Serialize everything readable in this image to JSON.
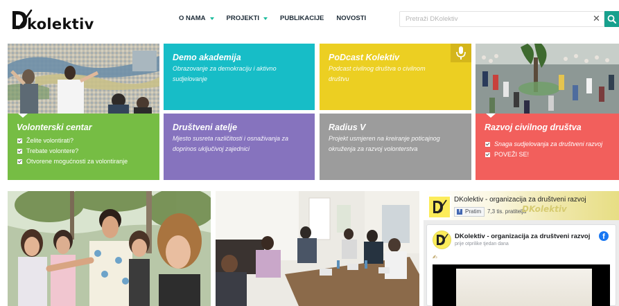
{
  "header": {
    "logo_text": "kolektiv",
    "nav": [
      {
        "label": "O NAMA",
        "has_dropdown": true
      },
      {
        "label": "PROJEKTI",
        "has_dropdown": true
      },
      {
        "label": "PUBLIKACIJE",
        "has_dropdown": false
      },
      {
        "label": "NOVOSTI",
        "has_dropdown": false
      }
    ],
    "search": {
      "placeholder": "Pretraži DKolektiv",
      "value": "",
      "clear_icon": "close-icon",
      "button_icon": "search-icon"
    }
  },
  "tiles": {
    "volonterski": {
      "title": "Volonterski centar",
      "color": "#76bd44",
      "items": [
        "Želite volontirati?",
        "Trebate volontere?",
        "Otvorene mogućnosti za volontiranje"
      ]
    },
    "demo": {
      "title": "Demo akademija",
      "desc": "Obrazovanje za demokraciju i aktivno sudjelovanje",
      "color": "#17bdc7"
    },
    "podcast": {
      "title": "PoDcast Kolektiv",
      "desc": "Podcast civilnog društva o civilnom društvu",
      "color": "#eccf22",
      "icon": "microphone-icon"
    },
    "atelje": {
      "title": "Društveni atelje",
      "desc": "Mjesto susreta različitosti i osnaživanja za doprinos uključivoj zajednici",
      "color": "#8673be"
    },
    "radius": {
      "title": "Radius V",
      "desc": "Projekt usmjeren na kreiranje poticajnog okruženja za razvoj volonterstva",
      "color": "#9c9c9c"
    },
    "razvoj": {
      "title": "Razvoj civilnog društva",
      "color": "#f25f5c",
      "items": [
        "Snaga sudjelovanja za društveni razvoj",
        "POVEŽI SE!"
      ]
    }
  },
  "facebook": {
    "page_name": "DKolektiv - organizacija za društveni razvoj",
    "follow_label": "Pratim",
    "followers": "7,3 tis. pratitelja",
    "cover_brand": "DKolektiv",
    "post": {
      "author": "DKolektiv - organizacija za društveni razvoj",
      "time": "prije otprilike tjedan dana"
    }
  }
}
